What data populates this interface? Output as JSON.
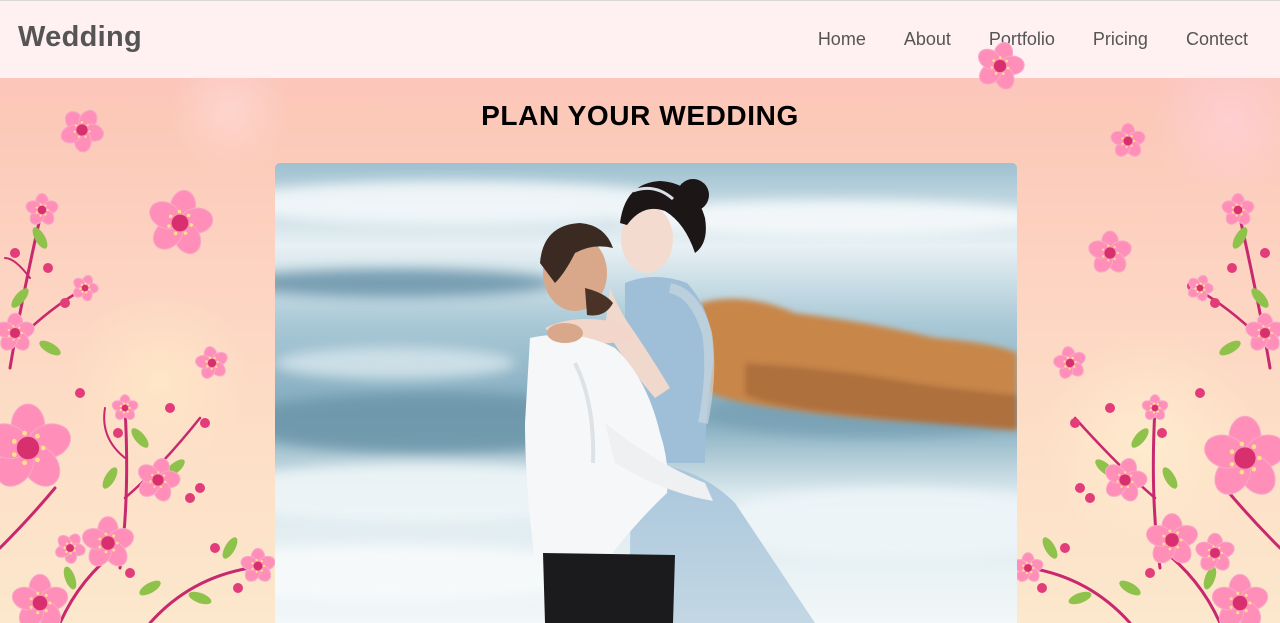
{
  "header": {
    "brand": "Wedding",
    "nav": [
      "Home",
      "About",
      "Portfolio",
      "Pricing",
      "Contect"
    ]
  },
  "hero": {
    "title": "PLAN YOUR WEDDING"
  },
  "colors": {
    "blossom": "#ff8fb8",
    "blossom_center": "#d8306e",
    "stem": "#c8286e",
    "leaf": "#8fc24a",
    "bud": "#e23c7a"
  },
  "icons": {
    "blossom": "cherry-blossom-icon"
  }
}
